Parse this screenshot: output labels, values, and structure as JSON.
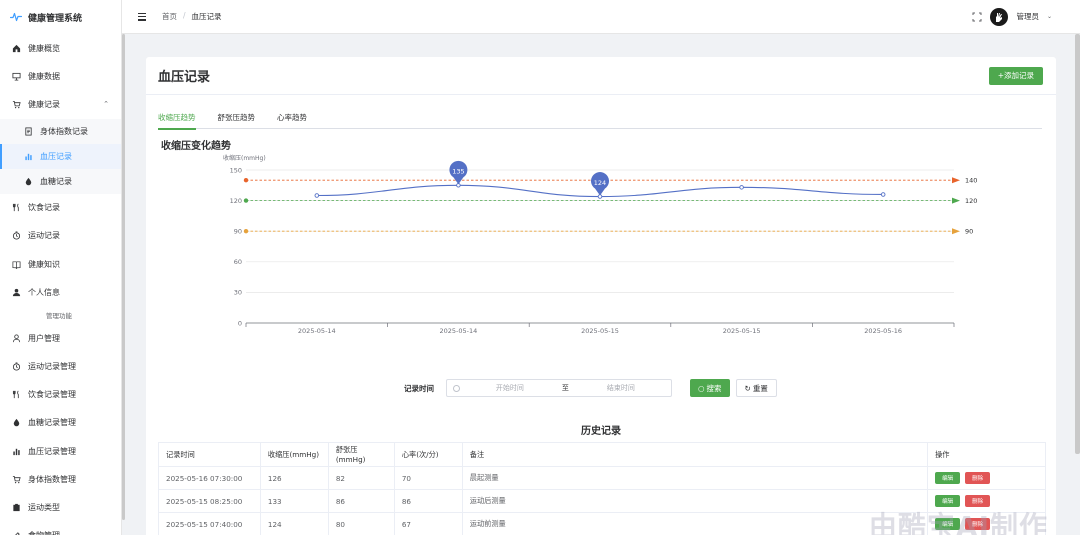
{
  "app": {
    "title": "健康管理系统"
  },
  "sidebar": {
    "items": [
      {
        "label": "健康概览",
        "icon": "home-icon"
      },
      {
        "label": "健康数据",
        "icon": "monitor-icon"
      },
      {
        "label": "健康记录",
        "icon": "cart-icon",
        "expanded": true
      },
      {
        "label": "身体指数记录",
        "icon": "document-icon",
        "sub": true
      },
      {
        "label": "血压记录",
        "icon": "bar-chart-icon",
        "sub": true,
        "active": true
      },
      {
        "label": "血糖记录",
        "icon": "drop-icon",
        "sub": true
      },
      {
        "label": "饮食记录",
        "icon": "fork-knife-icon"
      },
      {
        "label": "运动记录",
        "icon": "timer-icon"
      },
      {
        "label": "健康知识",
        "icon": "book-icon"
      },
      {
        "label": "个人信息",
        "icon": "user-icon"
      }
    ],
    "group_label": "管理功能",
    "admin_items": [
      {
        "label": "用户管理",
        "icon": "user-outline-icon"
      },
      {
        "label": "运动记录管理",
        "icon": "timer-icon"
      },
      {
        "label": "饮食记录管理",
        "icon": "fork-knife-icon"
      },
      {
        "label": "血糖记录管理",
        "icon": "drop-icon"
      },
      {
        "label": "血压记录管理",
        "icon": "bar-chart-icon"
      },
      {
        "label": "身体指数管理",
        "icon": "cart-icon"
      },
      {
        "label": "运动类型",
        "icon": "clipboard-icon"
      },
      {
        "label": "食物管理",
        "icon": "edit-icon"
      }
    ]
  },
  "topbar": {
    "breadcrumb": [
      "首页",
      "血压记录"
    ],
    "user_name": "管理员"
  },
  "page": {
    "title": "血压记录",
    "add_button": "+添加记录",
    "tabs": [
      "收缩压趋势",
      "舒张压趋势",
      "心率趋势"
    ],
    "active_tab": 0
  },
  "chart_data": {
    "type": "line",
    "title": "收缩压变化趋势",
    "ylabel": "收缩压(mmHg)",
    "ylim": [
      0,
      150
    ],
    "yticks": [
      0,
      30,
      60,
      90,
      120,
      150
    ],
    "categories": [
      "2025-05-14",
      "2025-05-14",
      "2025-05-15",
      "2025-05-15",
      "2025-05-16"
    ],
    "series": [
      {
        "values": [
          125,
          135,
          124,
          133,
          126
        ],
        "color": "#5470c6"
      }
    ],
    "markpoints": [
      {
        "index": 1,
        "value": 135,
        "label": "135"
      },
      {
        "index": 2,
        "value": 124,
        "label": "124"
      }
    ],
    "reference_lines": [
      {
        "value": 140,
        "label": "140",
        "color": "#e8642c"
      },
      {
        "value": 120,
        "label": "120",
        "color": "#4ea84e"
      },
      {
        "value": 90,
        "label": "90",
        "color": "#e6a23c"
      }
    ]
  },
  "search": {
    "label": "记录时间",
    "start_placeholder": "开始时间",
    "separator": "至",
    "end_placeholder": "结束时间",
    "search_button": "搜索",
    "reset_button": "重置"
  },
  "history": {
    "title": "历史记录",
    "columns": [
      "记录时间",
      "收缩压(mmHg)",
      "舒张压(mmHg)",
      "心率(次/分)",
      "备注",
      "操作"
    ],
    "rows": [
      [
        "2025-05-16 07:30:00",
        "126",
        "82",
        "70",
        "晨起测量"
      ],
      [
        "2025-05-15 08:25:00",
        "133",
        "86",
        "86",
        "运动后测量"
      ],
      [
        "2025-05-15 07:40:00",
        "124",
        "80",
        "67",
        "运动前测量"
      ]
    ],
    "edit_label": "编辑",
    "delete_label": "删除"
  },
  "watermark": "由酷宝AI制作"
}
